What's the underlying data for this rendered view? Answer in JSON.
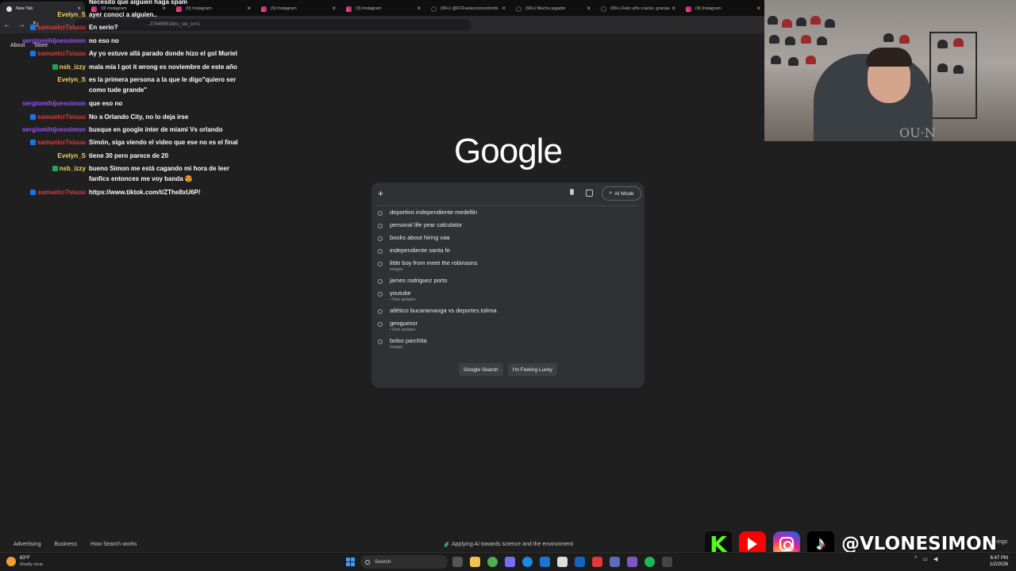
{
  "browser": {
    "tabs": [
      {
        "label": "New Tab",
        "icon": "chrome-icon",
        "active": true
      },
      {
        "label": "(9) Instagram",
        "icon": "instagram-icon"
      },
      {
        "label": "(9) Instagram",
        "icon": "instagram-icon"
      },
      {
        "label": "(9) Instagram",
        "icon": "instagram-icon"
      },
      {
        "label": "(9) Instagram",
        "icon": "instagram-icon"
      },
      {
        "label": "(99+) @FCFseleccioncolombi",
        "icon": "tiktok-icon"
      },
      {
        "label": "(99+) Mucho jugador",
        "icon": "tiktok-icon"
      },
      {
        "label": "(99+) Feliz año cracks, gracias",
        "icon": "tiktok-icon"
      },
      {
        "label": "(9) Instagram",
        "icon": "instagram-icon"
      }
    ],
    "url": "...376465518no_sw_cr=1"
  },
  "google": {
    "logo": "Google",
    "top_links": [
      "About",
      "Store"
    ],
    "ai_mode_label": "AI Mode",
    "suggestions": [
      {
        "text": "deportivo independiente medellin",
        "sub": ""
      },
      {
        "text": "personal life year calculator",
        "sub": ""
      },
      {
        "text": "books about hiring vaa",
        "sub": ""
      },
      {
        "text": "independiente santa fe",
        "sub": ""
      },
      {
        "text": "little boy from meet the robinsons",
        "sub": "Images"
      },
      {
        "text": "james rodriguez porto",
        "sub": ""
      },
      {
        "text": "youtube",
        "sub": "• New updates"
      },
      {
        "text": "atlético bucaramanga vs deportes tolima",
        "sub": ""
      },
      {
        "text": "geoguessr",
        "sub": "• New updates"
      },
      {
        "text": "bolso parchita",
        "sub": "Images"
      }
    ],
    "search_button": "Google Search",
    "lucky_button": "I'm Feeling Lucky",
    "footer_links": [
      "Advertising",
      "Business",
      "How Search works"
    ],
    "footer_center": "Applying AI towards science and the environment",
    "footer_right": "Settings"
  },
  "chat": [
    {
      "user": "",
      "text": "Necesito que alguien haga spam",
      "color": "#d43a3a"
    },
    {
      "user": "Evelyn_S",
      "text": "ayer conocí a alguien..",
      "color": "#f3d55b"
    },
    {
      "user": "samuelcr7siuuu",
      "text": "En serio?",
      "color": "#e23b3b"
    },
    {
      "user": "sergiomihijoessimon",
      "text": "no eso no",
      "color": "#9b53ff"
    },
    {
      "user": "samuelcr7siuuu",
      "text": "Ay yo estuve allá parado donde hizo el gol Muriel",
      "color": "#e23b3b"
    },
    {
      "user": "nsb_izzy",
      "text": "mala mía I got it wrong es noviembre de este año",
      "color": "#f3d55b"
    },
    {
      "user": "Evelyn_S",
      "text": "es la primera persona a la que le digo\"quiero ser como tude grande\"",
      "color": "#f3d55b"
    },
    {
      "user": "sergiomihijoessimon",
      "text": "que eso no",
      "color": "#9b53ff"
    },
    {
      "user": "samuelcr7siuuu",
      "text": "No a Orlando City, no lo deja irse",
      "color": "#e23b3b"
    },
    {
      "user": "sergiomihijoessimon",
      "text": "busque en google inter de miami Vs orlando",
      "color": "#9b53ff"
    },
    {
      "user": "samuelcr7siuuu",
      "text": "Simón, siga viendo el video que ese no es el final",
      "color": "#e23b3b"
    },
    {
      "user": "Evelyn_S",
      "text": "tiene 30 pero parece de 20",
      "color": "#f3d55b"
    },
    {
      "user": "nsb_izzy",
      "text": "bueno Simon me está cagando mi hora de leer fanfics entonces me voy banda 😍",
      "color": "#f3d55b"
    },
    {
      "user": "samuelcr7siuuu",
      "text": "https://www.tiktok.com/t/ZThe8xU6P/",
      "color": "#e23b3b"
    }
  ],
  "overlay": {
    "handle": "@VLONESIMON",
    "webcam_shirt": "OU·N"
  },
  "taskbar": {
    "weather_temp": "63°F",
    "weather_desc": "Mostly clear",
    "search_placeholder": "Search",
    "time": "6:47 PM",
    "date": "1/2/2026"
  }
}
